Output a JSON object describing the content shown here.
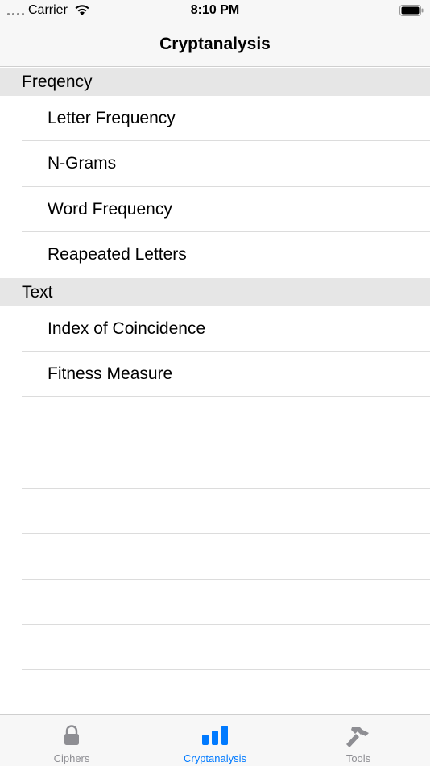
{
  "status_bar": {
    "carrier": "Carrier",
    "time": "8:10 PM"
  },
  "nav": {
    "title": "Cryptanalysis"
  },
  "sections": [
    {
      "header": "Freqency",
      "items": [
        "Letter Frequency",
        "N-Grams",
        "Word Frequency",
        "Reapeated Letters"
      ]
    },
    {
      "header": "Text",
      "items": [
        "Index of Coincidence",
        "Fitness Measure"
      ]
    }
  ],
  "tabs": [
    {
      "label": "Ciphers",
      "icon": "lock-icon",
      "selected": false
    },
    {
      "label": "Cryptanalysis",
      "icon": "chart-bars-icon",
      "selected": true
    },
    {
      "label": "Tools",
      "icon": "hammer-icon",
      "selected": false
    }
  ],
  "colors": {
    "accent": "#007aff",
    "inactive": "#8e8e93",
    "section_bg": "#e6e6e6",
    "bar_bg": "#f7f7f7"
  }
}
